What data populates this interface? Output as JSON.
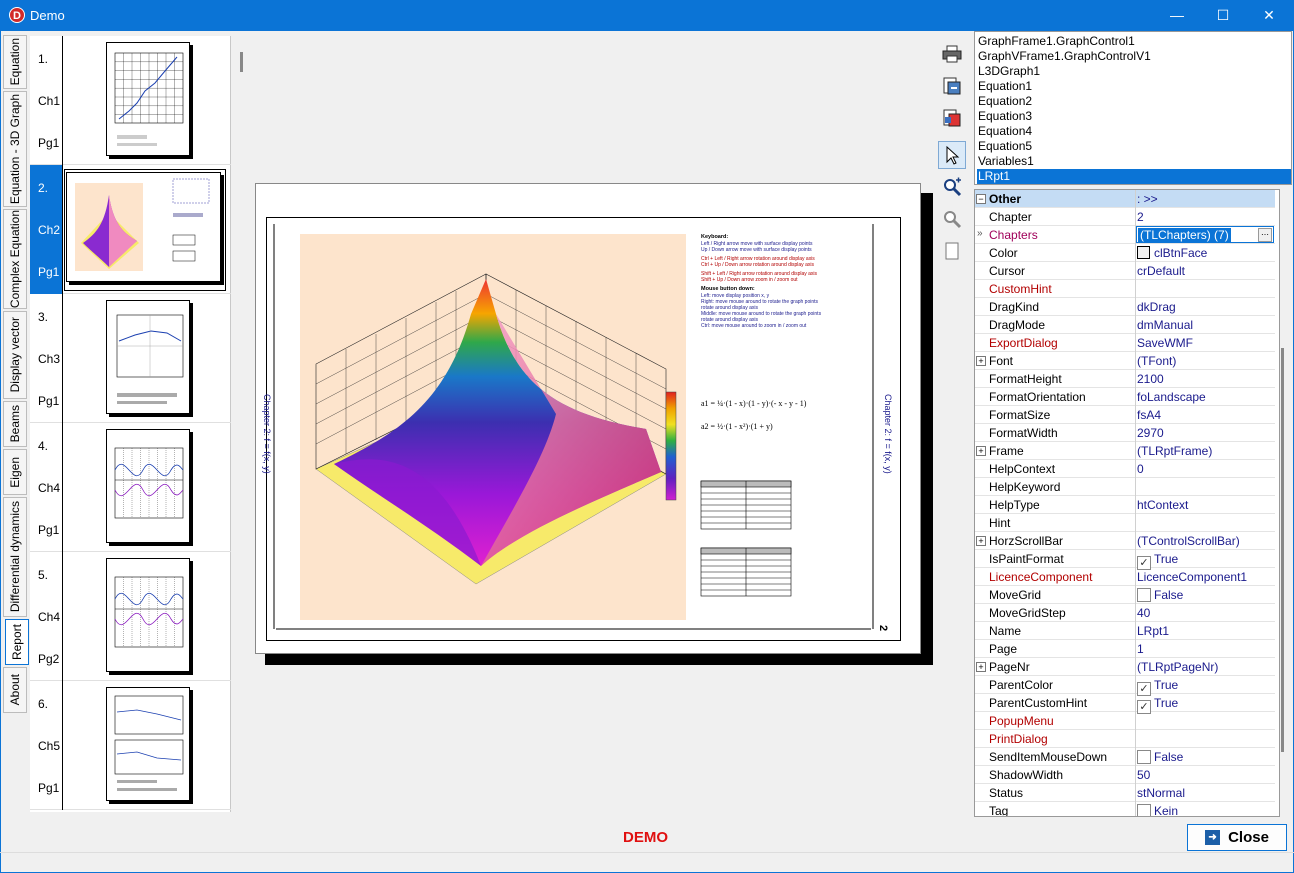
{
  "window": {
    "title": "Demo",
    "icon_letter": "D",
    "minimize": "—",
    "maximize": "☐",
    "close": "✕"
  },
  "tabs": [
    {
      "label": "Equation",
      "active": false
    },
    {
      "label": "Equation - 3D Graph",
      "active": false
    },
    {
      "label": "Complex Equation",
      "active": false
    },
    {
      "label": "Display vector",
      "active": false
    },
    {
      "label": "Beams",
      "active": false
    },
    {
      "label": "Eigen",
      "active": false
    },
    {
      "label": "Differential dynamics",
      "active": false
    },
    {
      "label": "Report",
      "active": true
    },
    {
      "label": "About",
      "active": false
    }
  ],
  "thumbnails": [
    {
      "num": "1.",
      "chapter": "Ch1",
      "page": "Pg1",
      "kind": "grid-line"
    },
    {
      "num": "2.",
      "chapter": "Ch2",
      "page": "Pg1",
      "kind": "3d"
    },
    {
      "num": "3.",
      "chapter": "Ch3",
      "page": "Pg1",
      "kind": "plot"
    },
    {
      "num": "4.",
      "chapter": "Ch4",
      "page": "Pg1",
      "kind": "wave"
    },
    {
      "num": "5.",
      "chapter": "Ch4",
      "page": "Pg2",
      "kind": "wave"
    },
    {
      "num": "6.",
      "chapter": "Ch5",
      "page": "Pg1",
      "kind": "dual"
    }
  ],
  "toolbar": {
    "print": "printer-icon",
    "export1": "export-icon",
    "export2": "export-red-icon",
    "select": "cursor-icon",
    "zoom_in": "zoom-in-icon",
    "zoom_out": "zoom-out-icon",
    "page": "page-icon"
  },
  "page": {
    "side_label_left": "Chapter 2:   f = f(x, y)",
    "side_label_right": "Chapter 2:   f = f(x, y)",
    "page_number": "2",
    "keyboard_title": "Keyboard:",
    "mouse_title": "Mouse button down:",
    "formula1": "a1 = ¼·(1 - x)·(1 - y)·(- x - y - 1)",
    "formula2": "a2 = ½·(1 - x²)·(1 + y)"
  },
  "components": [
    "GraphFrame1.GraphControl1",
    "GraphVFrame1.GraphControlV1",
    "L3DGraph1",
    "Equation1",
    "Equation2",
    "Equation3",
    "Equation4",
    "Equation5",
    "Variables1",
    "LRpt1"
  ],
  "selected_component": "LRpt1",
  "inspector": [
    {
      "name": "Other",
      "value": ": >>",
      "type": "header",
      "expand": "−"
    },
    {
      "name": "Chapter",
      "value": "2",
      "type": "normal"
    },
    {
      "name": "Chapters",
      "value": "(TLChapters) (7)",
      "type": "editing",
      "marker": "»"
    },
    {
      "name": "Color",
      "value": "clBtnFace",
      "type": "color"
    },
    {
      "name": "Cursor",
      "value": "crDefault",
      "type": "normal"
    },
    {
      "name": "CustomHint",
      "value": "",
      "type": "red"
    },
    {
      "name": "DragKind",
      "value": "dkDrag",
      "type": "normal"
    },
    {
      "name": "DragMode",
      "value": "dmManual",
      "type": "normal"
    },
    {
      "name": "ExportDialog",
      "value": "SaveWMF",
      "type": "red"
    },
    {
      "name": "Font",
      "value": "(TFont)",
      "type": "normal",
      "expand": "+"
    },
    {
      "name": "FormatHeight",
      "value": "2100",
      "type": "normal"
    },
    {
      "name": "FormatOrientation",
      "value": "foLandscape",
      "type": "normal"
    },
    {
      "name": "FormatSize",
      "value": "fsA4",
      "type": "normal"
    },
    {
      "name": "FormatWidth",
      "value": "2970",
      "type": "normal"
    },
    {
      "name": "Frame",
      "value": "(TLRptFrame)",
      "type": "normal",
      "expand": "+"
    },
    {
      "name": "HelpContext",
      "value": "0",
      "type": "normal"
    },
    {
      "name": "HelpKeyword",
      "value": "",
      "type": "normal"
    },
    {
      "name": "HelpType",
      "value": "htContext",
      "type": "normal"
    },
    {
      "name": "Hint",
      "value": "",
      "type": "normal"
    },
    {
      "name": "HorzScrollBar",
      "value": "(TControlScrollBar)",
      "type": "normal",
      "expand": "+"
    },
    {
      "name": "IsPaintFormat",
      "value": "True",
      "type": "check",
      "checked": true
    },
    {
      "name": "LicenceComponent",
      "value": "LicenceComponent1",
      "type": "red"
    },
    {
      "name": "MoveGrid",
      "value": "False",
      "type": "check",
      "checked": false
    },
    {
      "name": "MoveGridStep",
      "value": "40",
      "type": "normal"
    },
    {
      "name": "Name",
      "value": "LRpt1",
      "type": "normal"
    },
    {
      "name": "Page",
      "value": "1",
      "type": "normal"
    },
    {
      "name": "PageNr",
      "value": "(TLRptPageNr)",
      "type": "normal",
      "expand": "+"
    },
    {
      "name": "ParentColor",
      "value": "True",
      "type": "check",
      "checked": true
    },
    {
      "name": "ParentCustomHint",
      "value": "True",
      "type": "check",
      "checked": true
    },
    {
      "name": "PopupMenu",
      "value": "",
      "type": "red"
    },
    {
      "name": "PrintDialog",
      "value": "",
      "type": "red"
    },
    {
      "name": "SendItemMouseDown",
      "value": "False",
      "type": "check",
      "checked": false
    },
    {
      "name": "ShadowWidth",
      "value": "50",
      "type": "normal"
    },
    {
      "name": "Status",
      "value": "stNormal",
      "type": "normal"
    },
    {
      "name": "Tag",
      "value": "Kein",
      "type": "check",
      "checked": false
    }
  ],
  "footer": {
    "demo": "DEMO",
    "close": "Close"
  }
}
